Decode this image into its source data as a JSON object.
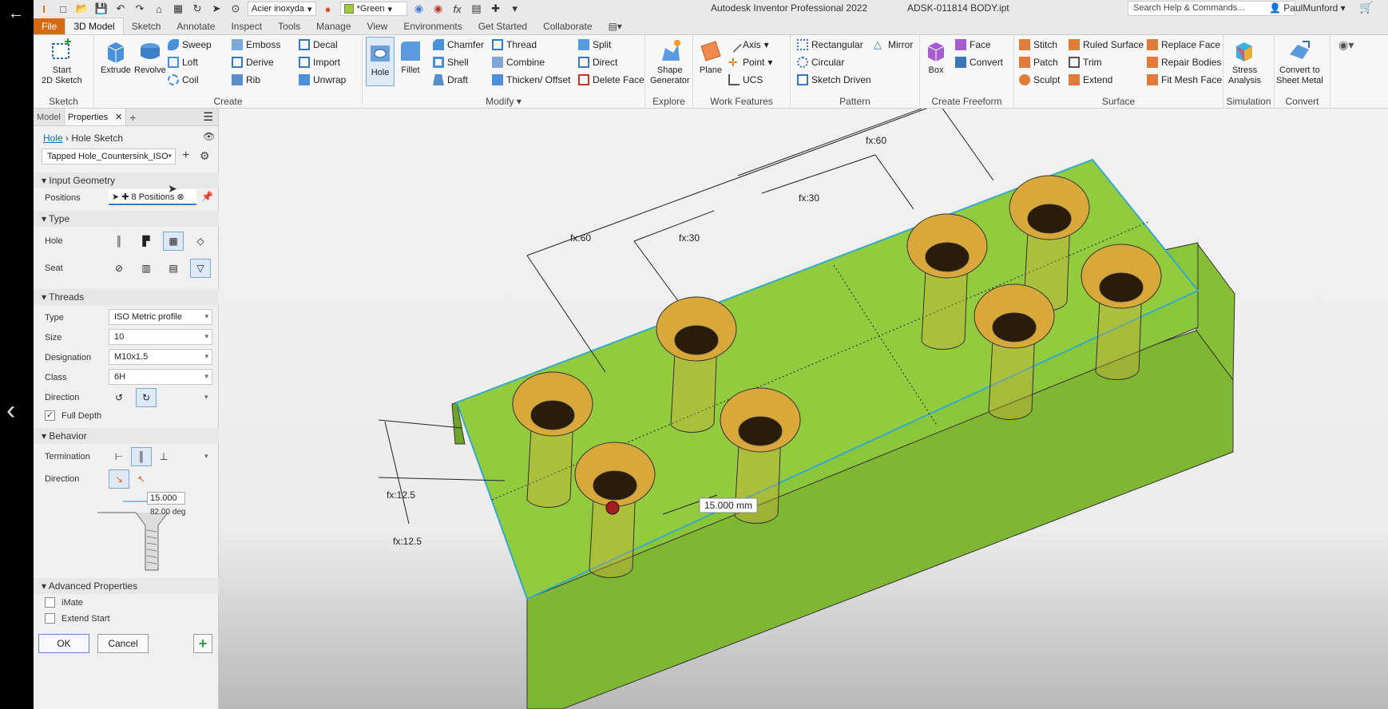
{
  "titlebar": {
    "material": "Acier inoxyda",
    "appearance": "*Green",
    "app_title": "Autodesk Inventor Professional 2022",
    "doc_title": "ADSK-011814 BODY.ipt",
    "search_placeholder": "Search Help & Commands...",
    "user": "PaulMunford"
  },
  "tabs": [
    "File",
    "3D Model",
    "Sketch",
    "Annotate",
    "Inspect",
    "Tools",
    "Manage",
    "View",
    "Environments",
    "Get Started",
    "Collaborate"
  ],
  "ribbon": {
    "sketch": {
      "title": "Sketch",
      "start": "Start\n2D Sketch"
    },
    "create": {
      "title": "Create",
      "extrude": "Extrude",
      "revolve": "Revolve",
      "sweep": "Sweep",
      "loft": "Loft",
      "coil": "Coil",
      "emboss": "Emboss",
      "derive": "Derive",
      "rib": "Rib",
      "decal": "Decal",
      "import": "Import",
      "unwrap": "Unwrap"
    },
    "modify": {
      "title": "Modify",
      "hole": "Hole",
      "fillet": "Fillet",
      "chamfer": "Chamfer",
      "shell": "Shell",
      "draft": "Draft",
      "thread": "Thread",
      "combine": "Combine",
      "thicken": "Thicken/ Offset",
      "split": "Split",
      "direct": "Direct",
      "delete_face": "Delete Face"
    },
    "explore": {
      "title": "Explore",
      "shape_gen": "Shape\nGenerator"
    },
    "work": {
      "title": "Work Features",
      "plane": "Plane",
      "axis": "Axis",
      "point": "Point",
      "ucs": "UCS"
    },
    "pattern": {
      "title": "Pattern",
      "rectangular": "Rectangular",
      "circular": "Circular",
      "sketch_driven": "Sketch Driven",
      "mirror": "Mirror"
    },
    "freeform": {
      "title": "Create Freeform",
      "box": "Box",
      "face": "Face",
      "convert": "Convert"
    },
    "surface": {
      "title": "Surface",
      "stitch": "Stitch",
      "patch": "Patch",
      "sculpt": "Sculpt",
      "ruled": "Ruled Surface",
      "trim": "Trim",
      "extend": "Extend",
      "replace_face": "Replace Face",
      "repair": "Repair Bodies",
      "fit_mesh": "Fit Mesh Face"
    },
    "simulation": {
      "title": "Simulation",
      "stress": "Stress\nAnalysis"
    },
    "convert": {
      "title": "Convert",
      "sheet_metal": "Convert to\nSheet Metal"
    }
  },
  "panel": {
    "tab_model": "Model",
    "tab_properties": "Properties",
    "crumb_link": "Hole",
    "crumb_current": "Hole Sketch",
    "preset": "Tapped Hole_Countersink_ISO",
    "input_geometry": "Input Geometry",
    "positions_label": "Positions",
    "positions_value": "8 Positions",
    "type_section": "Type",
    "hole_label": "Hole",
    "seat_label": "Seat",
    "threads_section": "Threads",
    "thread_type_label": "Type",
    "thread_type": "ISO Metric profile",
    "size_label": "Size",
    "size": "10",
    "designation_label": "Designation",
    "designation": "M10x1.5",
    "class_label": "Class",
    "class": "6H",
    "direction_label": "Direction",
    "full_depth": "Full Depth",
    "behavior_section": "Behavior",
    "termination_label": "Termination",
    "behavior_direction_label": "Direction",
    "cs_diameter": "15.000",
    "cs_angle": "82.00 deg",
    "advanced_section": "Advanced Properties",
    "imate": "iMate",
    "extend_start": "Extend Start",
    "ok": "OK",
    "cancel": "Cancel"
  },
  "viewport": {
    "dim_60a": "fx:60",
    "dim_60b": "fx:60",
    "dim_30a": "fx:30",
    "dim_30b": "fx:30",
    "dim_125a": "fx:12.5",
    "dim_125b": "fx:12.5",
    "diameter_input": "15.000 mm",
    "body_color": "#8fc93a",
    "hole_color": "#d8a83a"
  }
}
